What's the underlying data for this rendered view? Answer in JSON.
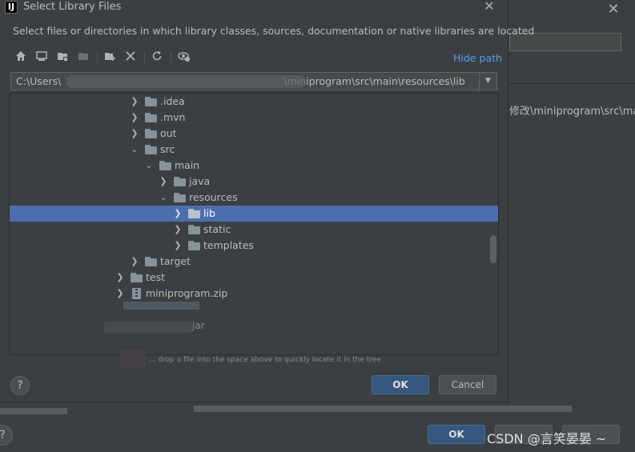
{
  "dialog": {
    "title": "Select Library Files",
    "app_icon_letter": "IJ",
    "description": "Select files or directories in which library classes, sources, documentation or native libraries are located",
    "hide_path_label": "Hide path",
    "path_start": "C:\\Users\\",
    "path_end": "\\miniprogram\\src\\main\\resources\\lib",
    "drop_hint": "... drop a file into the space above to quickly locate it in the tree",
    "ok_label": "OK",
    "cancel_label": "Cancel",
    "help_label": "?"
  },
  "toolbar": {
    "icons": [
      "home-icon",
      "desktop-icon",
      "project-folder-icon",
      "module-folder-icon",
      "new-folder-icon",
      "delete-icon",
      "refresh-icon",
      "show-hidden-icon"
    ]
  },
  "tree": {
    "items": [
      {
        "label": ".idea",
        "type": "folder",
        "expanded": false
      },
      {
        "label": ".mvn",
        "type": "folder",
        "expanded": false
      },
      {
        "label": "out",
        "type": "folder",
        "expanded": false
      },
      {
        "label": "src",
        "type": "folder",
        "expanded": true
      },
      {
        "label": "main",
        "type": "folder",
        "expanded": true
      },
      {
        "label": "java",
        "type": "folder",
        "expanded": false
      },
      {
        "label": "resources",
        "type": "folder",
        "expanded": true
      },
      {
        "label": "lib",
        "type": "folder",
        "expanded": false,
        "selected": true
      },
      {
        "label": "static",
        "type": "folder",
        "expanded": false
      },
      {
        "label": "templates",
        "type": "folder",
        "expanded": false
      },
      {
        "label": "target",
        "type": "folder",
        "expanded": false
      },
      {
        "label": "test",
        "type": "folder",
        "expanded": false
      },
      {
        "label": "miniprogram.zip",
        "type": "zip",
        "expanded": false
      }
    ],
    "blurred_jar_suffix": "jar"
  },
  "background": {
    "path_fragment": "修改\\miniprogram\\src\\main",
    "ok_label": "OK",
    "help_label": "?"
  },
  "watermark": "CSDN @言笑晏晏 ~",
  "colors": {
    "dialog_bg": "#3c3f41",
    "selection": "#4b6eaf",
    "link": "#589df6",
    "primary_button": "#365880"
  }
}
